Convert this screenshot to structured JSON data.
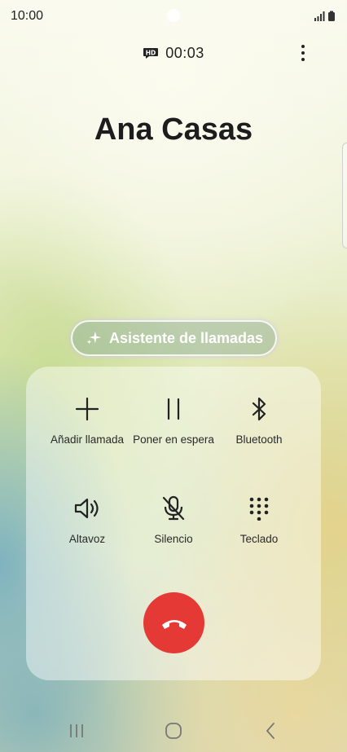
{
  "status_bar": {
    "time": "10:00"
  },
  "call": {
    "duration": "00:03",
    "caller_name": "Ana Casas"
  },
  "assistant": {
    "label": "Asistente de llamadas"
  },
  "controls": [
    {
      "label": "Añadir llamada",
      "icon": "plus-icon"
    },
    {
      "label": "Poner en espera",
      "icon": "pause-icon"
    },
    {
      "label": "Bluetooth",
      "icon": "bluetooth-icon"
    },
    {
      "label": "Altavoz",
      "icon": "speaker-icon"
    },
    {
      "label": "Silencio",
      "icon": "mic-off-icon"
    },
    {
      "label": "Teclado",
      "icon": "keypad-icon"
    }
  ],
  "colors": {
    "end_call": "#e53935",
    "text": "#1d1d1d"
  }
}
